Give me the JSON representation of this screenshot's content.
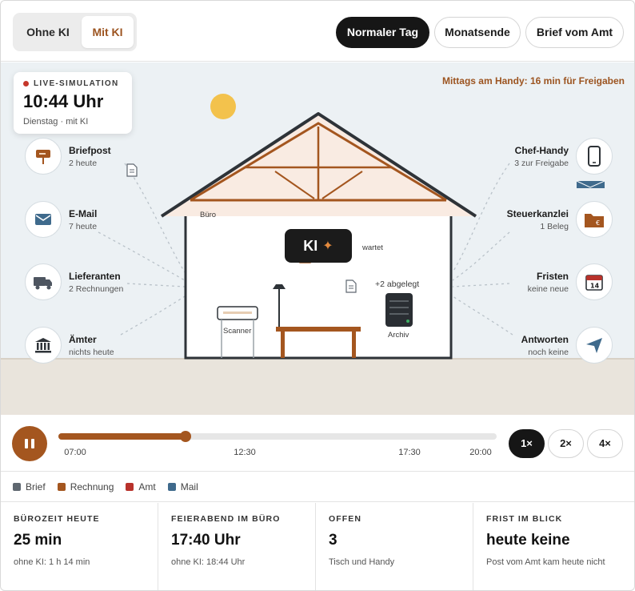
{
  "toggle": {
    "off_label": "Ohne KI",
    "on_label": "Mit KI"
  },
  "scenarios": [
    "Normaler Tag",
    "Monatsende",
    "Brief vom Amt"
  ],
  "live": {
    "label": "LIVE-SIMULATION",
    "time": "10:44 Uhr",
    "sub": "Dienstag · mit KI"
  },
  "hint": "Mittags am Handy: 16 min für Freigaben",
  "sources_left": [
    {
      "title": "Briefpost",
      "sub": "2 heute",
      "icon": "mailbox-icon"
    },
    {
      "title": "E-Mail",
      "sub": "7 heute",
      "icon": "envelope-icon"
    },
    {
      "title": "Lieferanten",
      "sub": "2 Rechnungen",
      "icon": "truck-icon"
    },
    {
      "title": "Ämter",
      "sub": "nichts heute",
      "icon": "government-building-icon"
    }
  ],
  "sources_right": [
    {
      "title": "Chef-Handy",
      "sub": "3 zur Freigabe",
      "icon": "phone-icon"
    },
    {
      "title": "Steuerkanzlei",
      "sub": "1 Beleg",
      "icon": "folder-euro-icon"
    },
    {
      "title": "Fristen",
      "sub": "keine neue",
      "icon": "calendar-icon"
    },
    {
      "title": "Antworten",
      "sub": "noch keine",
      "icon": "send-icon"
    }
  ],
  "calendar_day": "14",
  "office": {
    "room_label": "Büro",
    "ki_label": "KI",
    "ki_status": "wartet",
    "archived": "+2 abgelegt",
    "archive_label": "Archiv",
    "scanner_label": "Scanner"
  },
  "timeline": {
    "ticks": [
      "07:00",
      "12:30",
      "17:30",
      "20:00"
    ],
    "progress": 0.291,
    "speeds": [
      "1×",
      "2×",
      "4×"
    ],
    "active_speed": "1×"
  },
  "legend": [
    {
      "label": "Brief",
      "color": "#5f6770"
    },
    {
      "label": "Rechnung",
      "color": "#a4561f"
    },
    {
      "label": "Amt",
      "color": "#b8322b"
    },
    {
      "label": "Mail",
      "color": "#3f6a8c"
    }
  ],
  "stats": [
    {
      "label": "BÜROZEIT HEUTE",
      "value": "25 min",
      "sub": "ohne KI: 1 h 14 min"
    },
    {
      "label": "FEIERABEND IM BÜRO",
      "value": "17:40 Uhr",
      "sub": "ohne KI: 18:44 Uhr"
    },
    {
      "label": "OFFEN",
      "value": "3",
      "sub": "Tisch und Handy"
    },
    {
      "label": "FRIST IM BLICK",
      "value": "heute keine",
      "sub": "Post vom Amt kam heute nicht"
    }
  ],
  "colors": {
    "accent": "#a4561f",
    "dark": "#161616",
    "sky": "#ecf1f4",
    "ground": "#e9e4dc",
    "sun": "#f3c24c"
  }
}
